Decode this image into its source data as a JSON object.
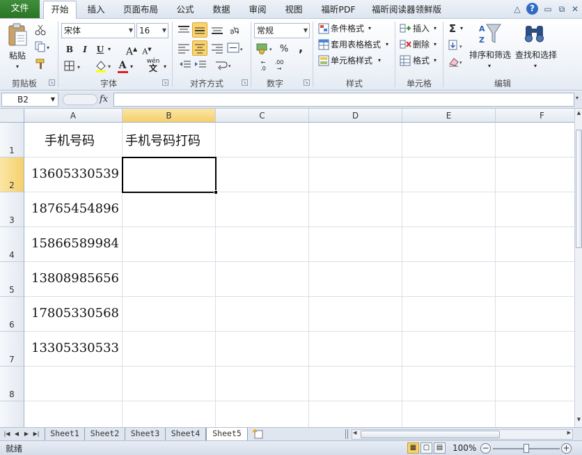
{
  "tabs": {
    "file": "文件",
    "items": [
      "开始",
      "插入",
      "页面布局",
      "公式",
      "数据",
      "审阅",
      "视图",
      "福昕PDF",
      "福昕阅读器领鲜版"
    ]
  },
  "window_controls": {
    "collapse": "△",
    "help": "?",
    "minimize": "▭",
    "restore": "⧉",
    "close": "✕"
  },
  "ribbon": {
    "clipboard": {
      "paste": "粘贴",
      "label": "剪贴板"
    },
    "font": {
      "name": "宋体",
      "size": "16",
      "bold": "B",
      "italic": "I",
      "underline": "U",
      "grow": "A",
      "shrink": "A",
      "color_letter": "A",
      "wen": "wén",
      "label": "字体"
    },
    "align": {
      "label": "对齐方式"
    },
    "number": {
      "format": "常规",
      "percent": "%",
      "comma": ",",
      "inc": ".0",
      "dec": ".00",
      "label": "数字"
    },
    "styles": {
      "conditional": "条件格式",
      "table": "套用表格格式",
      "cell": "单元格样式",
      "label": "样式"
    },
    "cells": {
      "insert": "插入",
      "delete": "删除",
      "format": "格式",
      "label": "单元格"
    },
    "editing": {
      "sigma": "Σ",
      "sort": "排序和筛选",
      "find": "查找和选择",
      "label": "编辑"
    }
  },
  "formula_bar": {
    "name_box": "B2",
    "fx": "fx",
    "value": ""
  },
  "grid": {
    "columns": [
      "A",
      "B",
      "C",
      "D",
      "E",
      "F"
    ],
    "rows": [
      "1",
      "2",
      "3",
      "4",
      "5",
      "6",
      "7",
      "8"
    ],
    "header_row": [
      "手机号码",
      "手机号码打码"
    ],
    "phones": [
      "13605330539",
      "18765454896",
      "15866589984",
      "13808985656",
      "17805330568",
      "13305330533"
    ],
    "selected_cell": "B2"
  },
  "sheets": {
    "items": [
      "Sheet1",
      "Sheet2",
      "Sheet3",
      "Sheet4",
      "Sheet5"
    ],
    "active": "Sheet5"
  },
  "status": {
    "ready": "就绪",
    "zoom": "100%",
    "zoom_minus": "−",
    "zoom_plus": "+"
  }
}
